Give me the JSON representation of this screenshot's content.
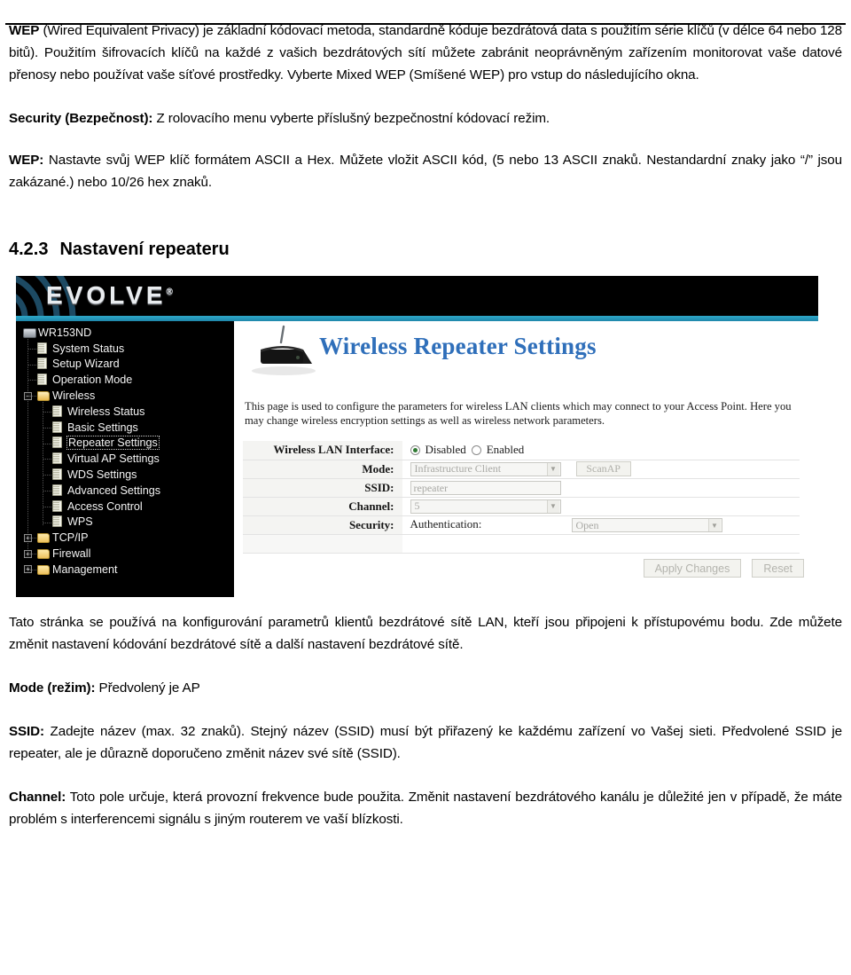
{
  "document": {
    "paragraphs": [
      {
        "id": "wep-intro",
        "bold_lead": "WEP",
        "text": " (Wired Equivalent Privacy) je základní kódovací metoda, standardně kóduje bezdrátová data s použitím série klíčů (v délce 64 nebo 128 bitů). Použitím šifrovacích klíčů na každé z vašich bezdrátových sítí můžete zabránit neoprávněným zařízením monitorovat vaše datové přenosy nebo používat vaše síťové prostředky. Vyberte Mixed WEP (Smíšené WEP) pro vstup do následujícího okna."
      },
      {
        "id": "security",
        "bold_lead": "Security (Bezpečnost):",
        "text": " Z rolovacího menu vyberte příslušný bezpečnostní kódovací režim."
      },
      {
        "id": "wep-key",
        "bold_lead": "WEP:",
        "text": " Nastavte svůj WEP klíč formátem ASCII a Hex. Můžete vložit ASCII kód, (5 nebo 13 ASCII znaků. Nestandardní znaky jako “/” jsou zakázané.) nebo 10/26 hex znaků."
      }
    ],
    "heading": {
      "number": "4.2.3",
      "title": "Nastavení repeateru"
    },
    "paragraphs_after": [
      {
        "id": "page-desc-cz",
        "bold_lead": "",
        "text": "Tato stránka se používá na konfigurování parametrů klientů bezdrátové sítě LAN, kteří jsou připojeni k přístupovému bodu. Zde můžete změnit nastavení kódování bezdrátové sítě a další nastavení bezdrátové sítě."
      },
      {
        "id": "mode-cz",
        "bold_lead": "Mode (režim):",
        "text": " Předvolený je AP"
      },
      {
        "id": "ssid-cz",
        "bold_lead": "SSID:",
        "text": " Zadejte název (max. 32 znaků). Stejný název (SSID) musí být přiřazený ke každému zařízení vo Vašej sieti. Předvolené SSID je repeater, ale je důrazně doporučeno změnit název své sítě (SSID)."
      },
      {
        "id": "channel-cz",
        "bold_lead": "Channel:",
        "text": " Toto pole určuje, která provozní frekvence bude použita. Změnit nastavení bezdrátového kanálu je důležité jen v případě, že máte problém s interferencemi signálu s jiným routerem ve vaší blízkosti."
      }
    ]
  },
  "screenshot": {
    "brand": "EVOLVE",
    "brand_mark": "®",
    "accent_color": "#2ea8c9",
    "sidebar": {
      "items": [
        {
          "label": "WR153ND",
          "level": 0,
          "icon": "router-icon",
          "expander": "",
          "selected": false
        },
        {
          "label": "System Status",
          "level": 1,
          "icon": "document-icon",
          "expander": "",
          "selected": false
        },
        {
          "label": "Setup Wizard",
          "level": 1,
          "icon": "document-icon",
          "expander": "",
          "selected": false
        },
        {
          "label": "Operation Mode",
          "level": 1,
          "icon": "document-icon",
          "expander": "",
          "selected": false
        },
        {
          "label": "Wireless",
          "level": 1,
          "icon": "folder-open-icon",
          "expander": "−",
          "selected": false
        },
        {
          "label": "Wireless Status",
          "level": 2,
          "icon": "document-icon",
          "expander": "",
          "selected": false
        },
        {
          "label": "Basic Settings",
          "level": 2,
          "icon": "document-icon",
          "expander": "",
          "selected": false
        },
        {
          "label": "Repeater Settings",
          "level": 2,
          "icon": "document-icon",
          "expander": "",
          "selected": true
        },
        {
          "label": "Virtual AP Settings",
          "level": 2,
          "icon": "document-icon",
          "expander": "",
          "selected": false
        },
        {
          "label": "WDS Settings",
          "level": 2,
          "icon": "document-icon",
          "expander": "",
          "selected": false
        },
        {
          "label": "Advanced Settings",
          "level": 2,
          "icon": "document-icon",
          "expander": "",
          "selected": false
        },
        {
          "label": "Access Control",
          "level": 2,
          "icon": "document-icon",
          "expander": "",
          "selected": false
        },
        {
          "label": "WPS",
          "level": 2,
          "icon": "document-icon",
          "expander": "",
          "selected": false
        },
        {
          "label": "TCP/IP",
          "level": 1,
          "icon": "folder-icon",
          "expander": "+",
          "selected": false
        },
        {
          "label": "Firewall",
          "level": 1,
          "icon": "folder-icon",
          "expander": "+",
          "selected": false
        },
        {
          "label": "Management",
          "level": 1,
          "icon": "folder-icon",
          "expander": "+",
          "selected": false
        }
      ]
    },
    "panel": {
      "title": "Wireless Repeater Settings",
      "description": "This page is used to configure the parameters for wireless LAN clients which may connect to your Access Point. Here you may change wireless encryption settings as well as wireless network parameters.",
      "fields": {
        "wlan_interface_label": "Wireless LAN Interface:",
        "wlan_disabled_label": "Disabled",
        "wlan_enabled_label": "Enabled",
        "wlan_selected": "Disabled",
        "mode_label": "Mode:",
        "mode_value": "Infrastructure Client",
        "scan_button": "ScanAP",
        "ssid_label": "SSID:",
        "ssid_value": "repeater",
        "channel_label": "Channel:",
        "channel_value": "5",
        "security_label": "Security:",
        "authentication_label": "Authentication:",
        "authentication_value": "Open"
      },
      "buttons": {
        "apply": "Apply Changes",
        "reset": "Reset"
      }
    }
  }
}
